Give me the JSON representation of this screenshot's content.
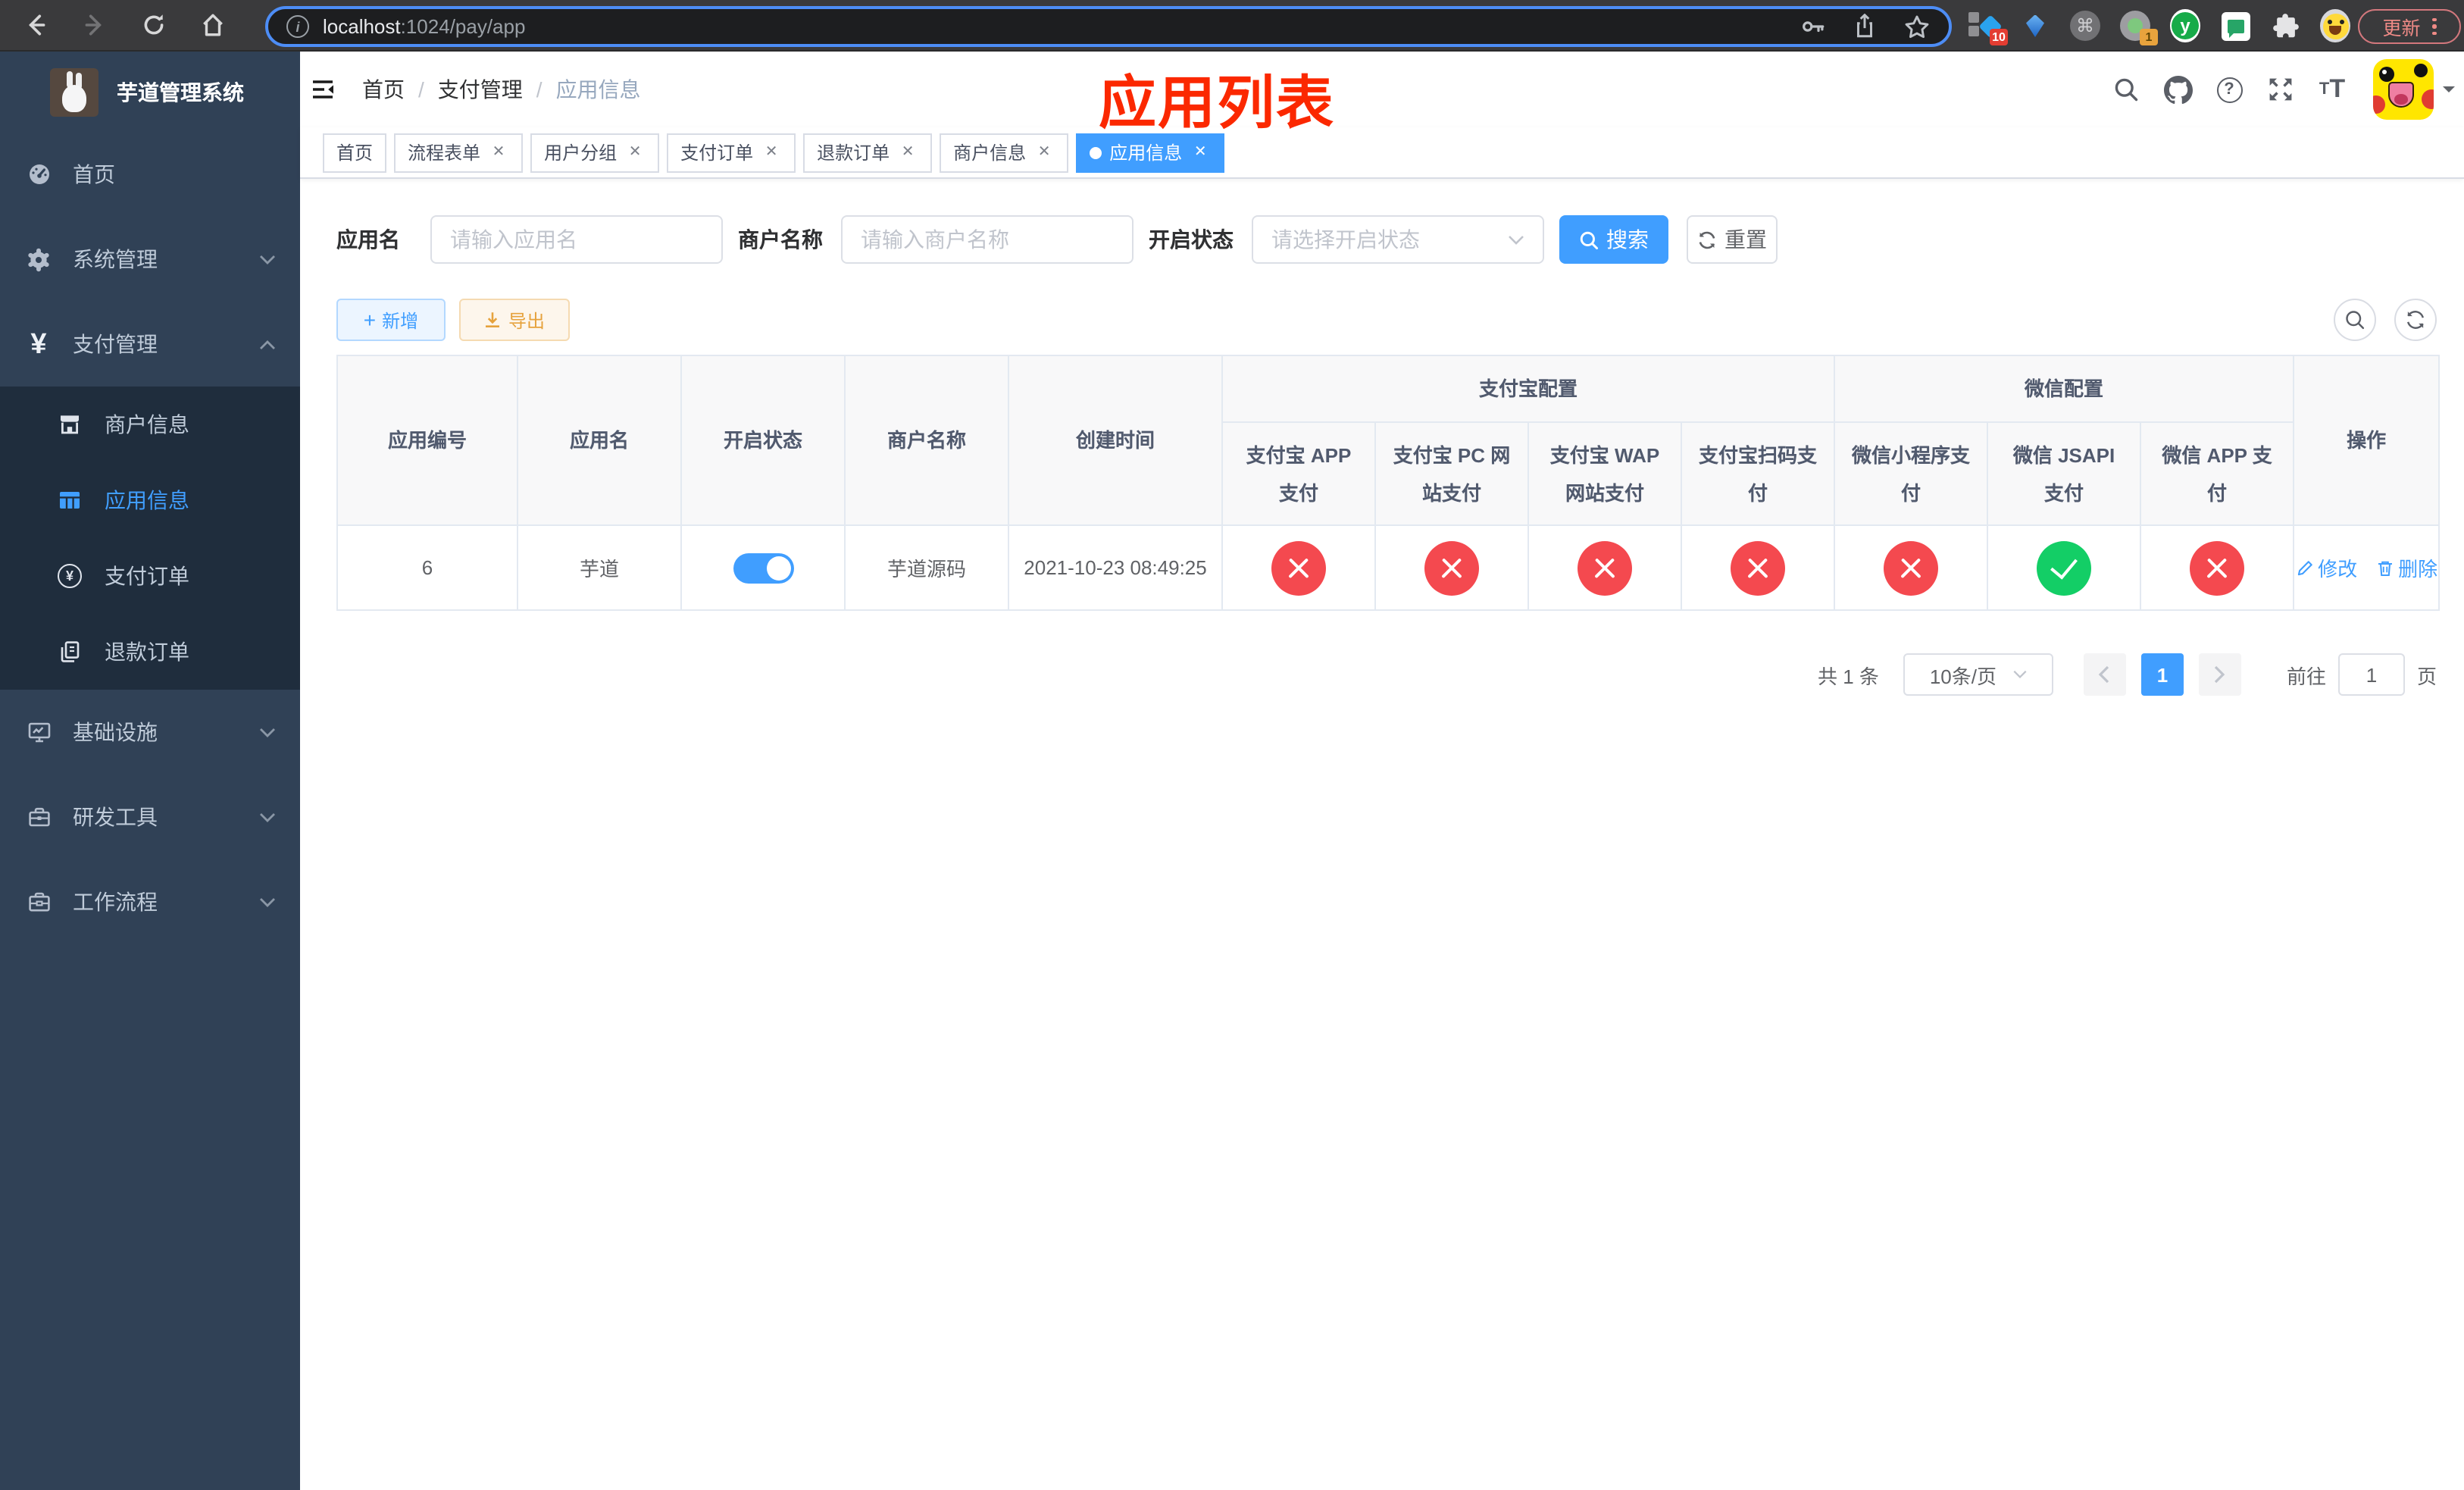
{
  "browser": {
    "url_host": "localhost",
    "url_rest": ":1024/pay/app",
    "update_label": "更新",
    "ext_badge_blue_diamond": "10",
    "ext_badge_record": "1",
    "ext_y_letter": "y",
    "ext_cmd": "⌘"
  },
  "sidebar": {
    "title": "芋道管理系统",
    "items": {
      "home": "首页",
      "system": "系统管理",
      "pay": "支付管理",
      "infra": "基础设施",
      "devtool": "研发工具",
      "workflow": "工作流程"
    },
    "pay_children": {
      "merchant": "商户信息",
      "app": "应用信息",
      "order": "支付订单",
      "refund": "退款订单"
    }
  },
  "navbar": {
    "breadcrumb": [
      "首页",
      "支付管理",
      "应用信息"
    ],
    "annotation": "应用列表"
  },
  "tabs": [
    {
      "label": "首页"
    },
    {
      "label": "流程表单"
    },
    {
      "label": "用户分组"
    },
    {
      "label": "支付订单"
    },
    {
      "label": "退款订单"
    },
    {
      "label": "商户信息"
    },
    {
      "label": "应用信息"
    }
  ],
  "filters": {
    "app_name_label": "应用名",
    "app_name_placeholder": "请输入应用名",
    "merchant_label": "商户名称",
    "merchant_placeholder": "请输入商户名称",
    "status_label": "开启状态",
    "status_placeholder": "请选择开启状态",
    "search_label": "搜索",
    "reset_label": "重置"
  },
  "toolbar": {
    "add_label": "新增",
    "export_label": "导出"
  },
  "table": {
    "headers": {
      "id": "应用编号",
      "name": "应用名",
      "status": "开启状态",
      "merchant": "商户名称",
      "created": "创建时间",
      "alipay_group": "支付宝配置",
      "wechat_group": "微信配置",
      "alipay_app": "支付宝 APP 支付",
      "alipay_pc": "支付宝 PC 网站支付",
      "alipay_wap": "支付宝 WAP 网站支付",
      "alipay_qr": "支付宝扫码支付",
      "wx_lite": "微信小程序支付",
      "wx_jsapi": "微信 JSAPI 支付",
      "wx_app": "微信 APP 支付",
      "ops": "操作"
    },
    "rows": [
      {
        "id": "6",
        "name": "芋道",
        "enabled": true,
        "merchant": "芋道源码",
        "created": "2021-10-23 08:49:25",
        "configs": [
          "false",
          "false",
          "false",
          "false",
          "false",
          "true",
          "false"
        ],
        "edit_label": "修改",
        "delete_label": "删除"
      }
    ]
  },
  "pagination": {
    "total": "共 1 条",
    "page_size": "10条/页",
    "current_page": "1",
    "goto_label": "前往",
    "goto_value": "1",
    "page_unit": "页"
  }
}
